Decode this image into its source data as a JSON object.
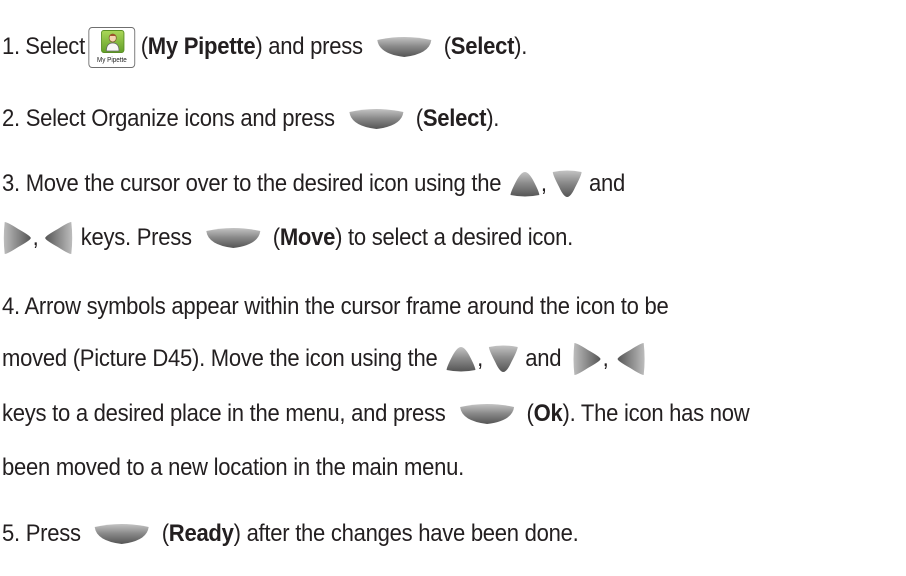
{
  "icon_label": "My Pipette",
  "step1": {
    "num": "1.",
    "select": "Select",
    "open1": "(",
    "my_pipette": "My Pipette",
    "close_press": ") and press",
    "open2": "(",
    "select_bold": "Select",
    "close_end": ")."
  },
  "step2": {
    "text": "2.  Select Organize icons and press",
    "open": "(",
    "select_bold": "Select",
    "close_end": ")."
  },
  "step3": {
    "text_a": "3.  Move the cursor over to the desired icon using the",
    "comma1": ",",
    "and1": "and",
    "comma2": ",",
    "keys_press": "keys. Press",
    "open": "(",
    "move_bold": "Move",
    "close_rest": ") to select a desired icon."
  },
  "step4": {
    "line1": "4.  Arrow symbols appear within the cursor frame around the icon to be",
    "line2a": "moved (Picture D45).  Move the icon using the",
    "comma1": ",",
    "and1": "and",
    "comma2": ",",
    "line3a": "keys to a desired place in the menu, and press",
    "open": "(",
    "ok_bold": "Ok",
    "close_rest": "). The icon has now",
    "line4": "been moved to a new location in the main menu."
  },
  "step5": {
    "press": "5.  Press",
    "open": "(",
    "ready_bold": "Ready",
    "close_rest": ") after the changes have been done."
  },
  "colors": {
    "text": "#231f20",
    "key_light": "#b9b9b9",
    "key_dark": "#5c5c5c",
    "icon_green": "#7cbb3a"
  }
}
